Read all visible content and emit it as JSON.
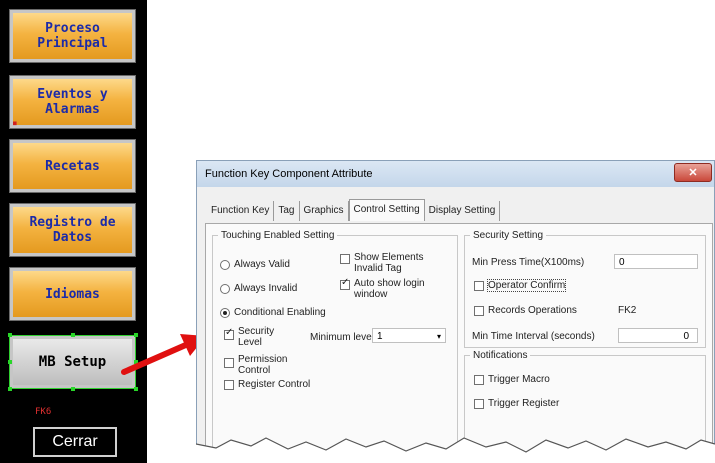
{
  "hmi": {
    "buttons": [
      "Proceso\nPrincipal",
      "Eventos y\nAlarmas",
      "Recetas",
      "Registro de\nDatos",
      "Idiomas",
      "MB Setup"
    ],
    "tag_label": "FK6",
    "close_label": "Cerrar"
  },
  "dialog": {
    "title": "Function Key Component Attribute",
    "close_glyph": "✕",
    "tabs": [
      "Function Key",
      "Tag",
      "Graphics",
      "Control Setting",
      "Display Setting"
    ],
    "active_tab": "Control Setting",
    "touching": {
      "legend": "Touching Enabled Setting",
      "always_valid": "Always Valid",
      "always_invalid": "Always Invalid",
      "conditional": "Conditional Enabling",
      "show_elements": "Show Elements\nInvalid Tag",
      "auto_show_login": "Auto show login\nwindow",
      "security_level": "Security\nLevel",
      "minimum_level_label": "Minimum level",
      "minimum_level_value": "1",
      "permission_control": "Permission\nControl",
      "register_control": "Register Control"
    },
    "security": {
      "legend": "Security Setting",
      "min_press_label": "Min Press Time(X100ms)",
      "min_press_value": "0",
      "operator_confirm": "Operator Confirm",
      "records_operations": "Records Operations",
      "records_value": "FK2",
      "min_time_label": "Min Time Interval (seconds)",
      "min_time_value": "0"
    },
    "notifications": {
      "legend": "Notifications",
      "trigger_macro": "Trigger Macro",
      "trigger_register": "Trigger Register"
    }
  },
  "colors": {
    "hmi_button_text": "#1c2ba8",
    "hmi_button_fill": "#f4b341",
    "arrow": "#e01010",
    "selection_handles": "#28d628"
  }
}
